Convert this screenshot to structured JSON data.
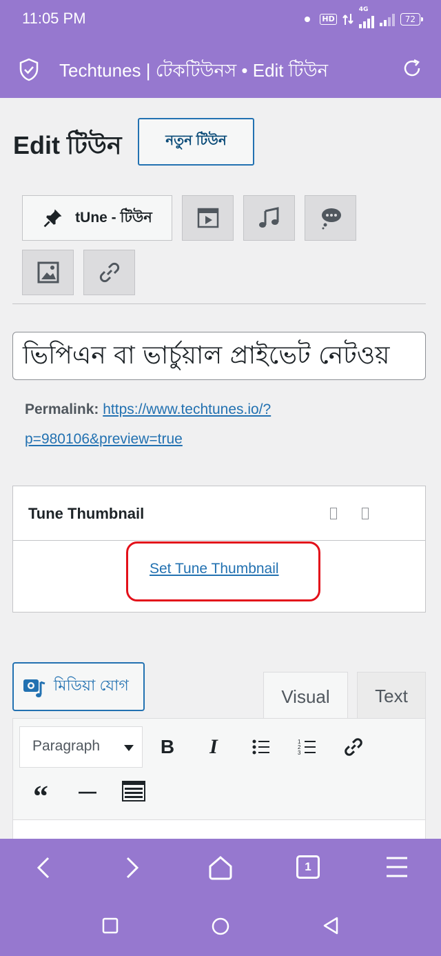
{
  "status_bar": {
    "time": "11:05 PM",
    "hd": "HD",
    "network": "4G",
    "battery": "72"
  },
  "browser": {
    "title": "Techtunes | টেকটিউনস • Edit টিউন",
    "icons": [
      "shield-check-icon",
      "reload-icon"
    ]
  },
  "page": {
    "heading": "Edit টিউন",
    "new_button": "নতুন টিউন"
  },
  "formats": {
    "active_label": "tUne - টিউন",
    "items": [
      "pin-icon",
      "video-icon",
      "audio-icon",
      "chat-icon",
      "image-icon",
      "link-icon"
    ]
  },
  "post": {
    "title_value": "ভিপিএন বা ভার্চুয়াল প্রাইভেট নেটওয়",
    "permalink_label": "Permalink:",
    "permalink_line1": "https://www.techtunes.io/?",
    "permalink_line2": "p=980106&preview=true"
  },
  "thumbnail": {
    "title": "Tune Thumbnail",
    "link": "Set Tune Thumbnail"
  },
  "editor": {
    "media_button": "মিডিয়া যোগ",
    "tab_visual": "Visual",
    "tab_text": "Text",
    "format_select": "Paragraph",
    "bold": "B",
    "italic": "I",
    "quote": "“",
    "hr": "—"
  },
  "bottom_nav": {
    "tab_count": "1"
  },
  "colors": {
    "accent": "#9678cf",
    "link": "#2271b1",
    "highlight": "#e3101a"
  }
}
